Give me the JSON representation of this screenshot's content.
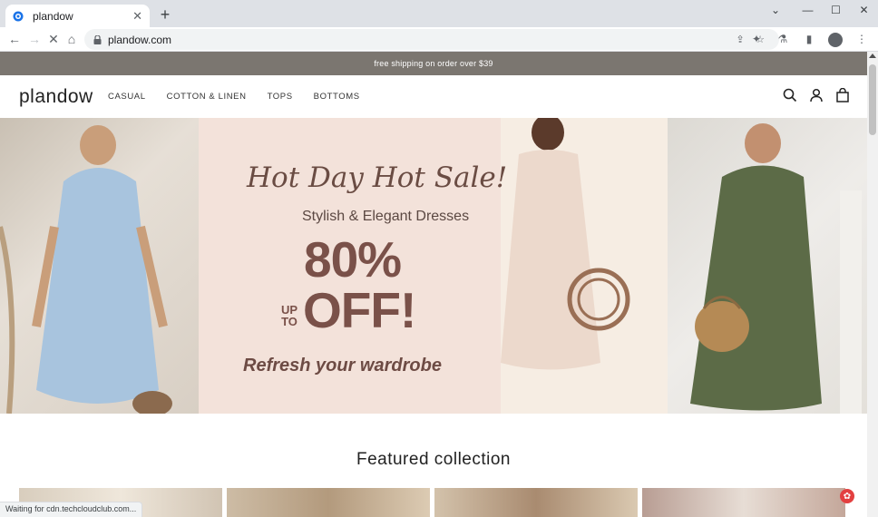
{
  "browser": {
    "tab_title": "plandow",
    "url": "plandow.com",
    "new_tab": "+",
    "status_text": "Waiting for cdn.techcloudclub.com..."
  },
  "store": {
    "announcement": "free shipping on order over $39",
    "logo": "plandow",
    "menu": [
      "CASUAL",
      "COTTON & LINEN",
      "TOPS",
      "BOTTOMS"
    ],
    "icons": [
      "search-icon",
      "account-icon",
      "cart-icon"
    ]
  },
  "hero": {
    "title": "Hot Day Hot Sale!",
    "subtitle": "Stylish & Elegant Dresses",
    "percent": "80%",
    "up": "UP",
    "to": "TO",
    "off": "OFF!",
    "tagline": "Refresh your wardrobe"
  },
  "featured": {
    "title": "Featured collection"
  },
  "colors": {
    "announcement_bg": "#7b7670",
    "hero_text": "#7a5149",
    "hero_pink": "#f3e2da"
  }
}
